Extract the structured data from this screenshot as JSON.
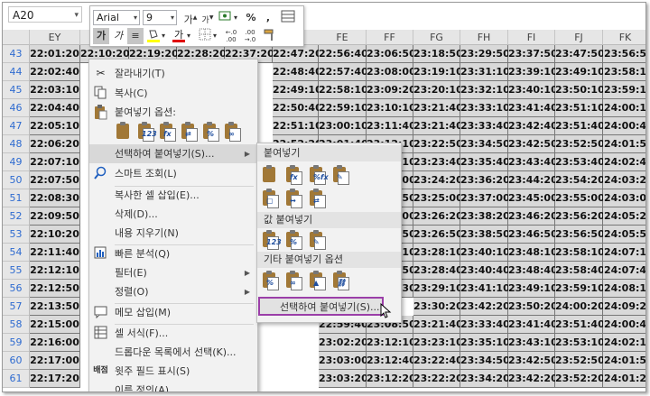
{
  "name_box": {
    "value": "A20"
  },
  "mini_toolbar": {
    "font": "Arial",
    "size": "9",
    "grow": "가",
    "shrink": "가",
    "percent": "%",
    "comma": ",",
    "bold": "가",
    "italic": "가"
  },
  "columns": [
    "EY",
    "FE",
    "FF",
    "FG",
    "FH",
    "FI",
    "FJ",
    "FK"
  ],
  "rows": [
    {
      "n": "43",
      "c": [
        "22:01:20",
        "22:10:20",
        "22:19:20",
        "22:28:20",
        "22:37:20",
        "22:47:20",
        "22:56:40",
        "23:06:50",
        "23:18:50",
        "23:29:50",
        "23:37:50",
        "23:47:50",
        "23:56:5"
      ]
    },
    {
      "n": "44",
      "c": [
        "22:02:40",
        "",
        "",
        "",
        "",
        "22:48:40",
        "22:57:40",
        "23:08:00",
        "23:19:10",
        "23:31:10",
        "23:39:10",
        "23:49:10",
        "23:58:1"
      ]
    },
    {
      "n": "45",
      "c": [
        "22:03:10",
        "",
        "",
        "",
        "",
        "22:49:10",
        "22:58:10",
        "23:09:20",
        "23:20:10",
        "23:32:10",
        "23:40:10",
        "23:50:10",
        "23:59:1"
      ]
    },
    {
      "n": "46",
      "c": [
        "22:04:40",
        "",
        "",
        "",
        "",
        "22:50:40",
        "22:59:10",
        "23:10:10",
        "23:21:40",
        "23:33:10",
        "23:41:40",
        "23:51:10",
        "24:00:1"
      ]
    },
    {
      "n": "47",
      "c": [
        "22:05:10",
        "",
        "",
        "",
        "",
        "22:51:10",
        "23:00:10",
        "23:11:40",
        "23:21:40",
        "23:33:40",
        "23:42:40",
        "23:51:40",
        "24:00:4"
      ]
    },
    {
      "n": "48",
      "c": [
        "22:06:20",
        "",
        "",
        "",
        "",
        "22:52:20",
        "23:01:40",
        "23:12:10",
        "23:22:50",
        "23:34:50",
        "23:42:50",
        "23:52:50",
        "24:01:5"
      ]
    },
    {
      "n": "49",
      "c": [
        "22:07:10",
        "",
        "",
        "",
        "",
        "",
        "",
        "23:13:10",
        "23:23:40",
        "23:35:40",
        "23:43:40",
        "23:53:40",
        "24:02:4"
      ]
    },
    {
      "n": "50",
      "c": [
        "22:07:50",
        "",
        "",
        "",
        "",
        "",
        "",
        "23:14:00",
        "23:24:20",
        "23:36:20",
        "23:44:20",
        "23:54:20",
        "24:03:2"
      ]
    },
    {
      "n": "51",
      "c": [
        "22:08:30",
        "",
        "",
        "",
        "",
        "",
        "",
        "23:14:50",
        "23:25:00",
        "23:37:00",
        "23:45:00",
        "23:55:00",
        "24:03:0"
      ]
    },
    {
      "n": "52",
      "c": [
        "22:09:50",
        "",
        "",
        "",
        "",
        "",
        "",
        "23:16:00",
        "23:26:20",
        "23:38:20",
        "23:46:20",
        "23:56:20",
        "24:05:2"
      ]
    },
    {
      "n": "53",
      "c": [
        "22:10:20",
        "",
        "",
        "",
        "",
        "",
        "",
        "23:16:50",
        "23:26:50",
        "23:38:50",
        "23:46:50",
        "23:56:50",
        "24:05:5"
      ]
    },
    {
      "n": "54",
      "c": [
        "22:11:40",
        "",
        "",
        "",
        "",
        "",
        "",
        "23:17:10",
        "23:28:10",
        "23:40:10",
        "23:48:10",
        "23:58:10",
        "24:07:1"
      ]
    },
    {
      "n": "55",
      "c": [
        "22:12:10",
        "",
        "",
        "",
        "",
        "",
        "",
        "23:17:50",
        "23:28:40",
        "23:40:40",
        "23:48:40",
        "23:58:40",
        "24:07:4"
      ]
    },
    {
      "n": "56",
      "c": [
        "22:12:50",
        "",
        "",
        "",
        "",
        "",
        "",
        "23:18:30",
        "23:29:10",
        "23:41:10",
        "23:49:10",
        "23:59:10",
        "24:08:1"
      ]
    },
    {
      "n": "57",
      "c": [
        "22:13:50",
        "",
        "",
        "",
        "",
        "",
        "",
        "",
        "23:30:20",
        "23:42:20",
        "23:50:20",
        "24:00:20",
        "24:09:2"
      ]
    },
    {
      "n": "58",
      "c": [
        "22:15:00",
        "",
        "",
        "",
        "",
        "",
        "22:59:40",
        "23:08:50",
        "23:21:40",
        "23:33:40",
        "23:41:40",
        "23:51:40",
        "24:00:4"
      ]
    },
    {
      "n": "59",
      "c": [
        "22:16:00",
        "",
        "",
        "",
        "",
        "",
        "23:02:20",
        "23:12:10",
        "23:23:10",
        "23:35:10",
        "23:43:10",
        "23:53:10",
        "24:02:1"
      ]
    },
    {
      "n": "60",
      "c": [
        "22:17:00",
        "",
        "",
        "",
        "",
        "",
        "23:03:00",
        "23:12:40",
        "23:22:40",
        "23:34:50",
        "23:42:50",
        "23:52:50",
        "24:01:5"
      ]
    },
    {
      "n": "61",
      "c": [
        "22:17:20",
        "",
        "",
        "",
        "",
        "",
        "23:03:20",
        "23:12:20",
        "23:22:20",
        "23:34:20",
        "23:42:20",
        "23:52:20",
        "24:01:2"
      ]
    }
  ],
  "context_menu": {
    "cut": "잘라내기(T)",
    "copy": "복사(C)",
    "paste_options": "붙여넣기 옵션:",
    "paste_special": "선택하여 붙여넣기(S)...",
    "smart_lookup": "스마트 조회(L)",
    "insert_copied": "복사한 셀 삽입(E)...",
    "delete": "삭제(D)...",
    "clear": "내용 지우기(N)",
    "quick_analysis": "빠른 분석(Q)",
    "filter": "필터(E)",
    "sort": "정렬(O)",
    "insert_comment": "메모 삽입(M)",
    "format_cells": "셀 서식(F)...",
    "pick_list": "드롭다운 목록에서 선택(K)...",
    "phonetic": "윗주 필드 표시(S)",
    "define_name": "이름 정의(A)..."
  },
  "submenu": {
    "paste_header": "붙여넣기",
    "values_header": "값 붙여넣기",
    "other_header": "기타 붙여넣기 옵션",
    "paste_special": "선택하여 붙여넣기(S)..."
  },
  "accent": "#9b3fa8"
}
